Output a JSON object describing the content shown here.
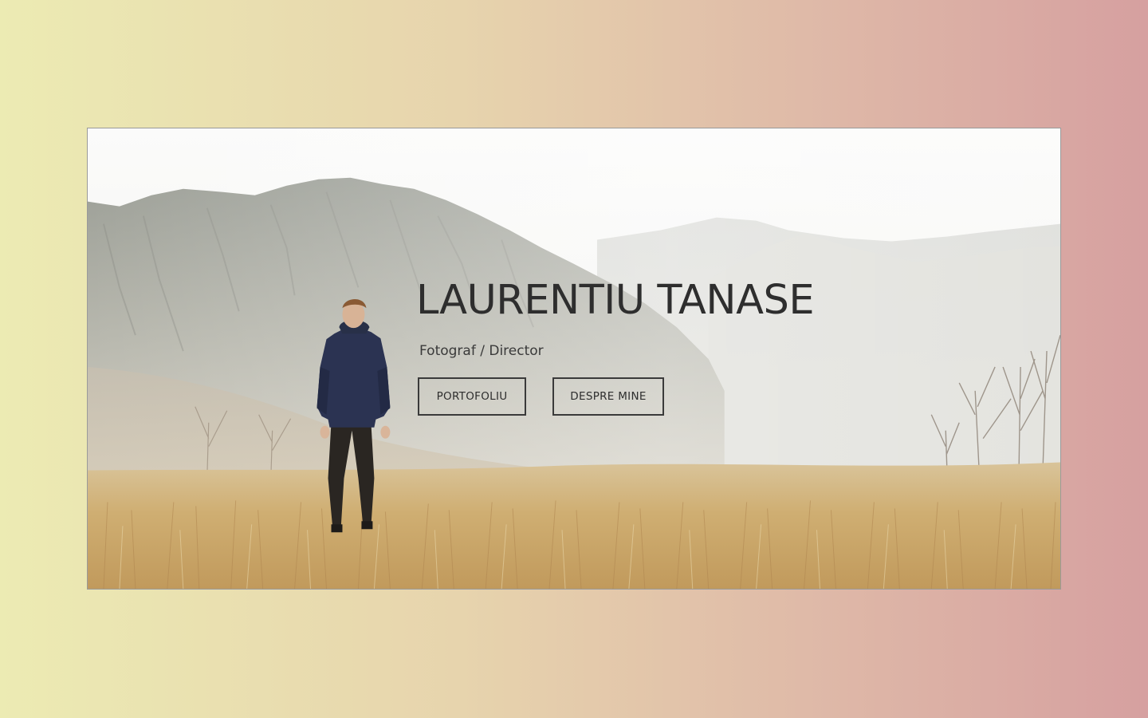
{
  "page": {
    "background_gradient": [
      "#ecebb3",
      "#e7d4ad",
      "#dfbaa8",
      "#d6a0a0"
    ]
  },
  "hero": {
    "title": "LAURENTIU TANASE",
    "subtitle": "Fotograf / Director",
    "text_color": "#2e2e2e",
    "buttons": {
      "portfolio_label": "PORTOFOLIU",
      "about_label": "DESPRE MINE"
    },
    "image": {
      "icon": "landscape-photo-person-mountains"
    }
  }
}
